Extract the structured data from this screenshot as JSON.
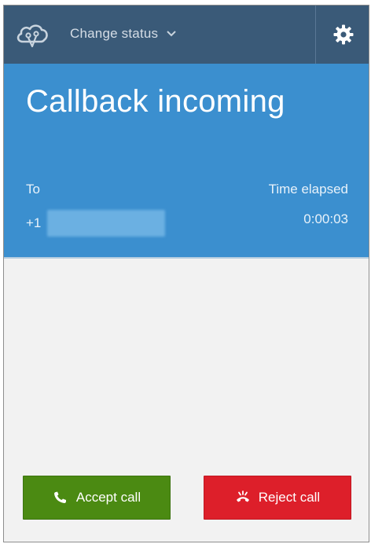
{
  "header": {
    "logo_icon": "cloud-agent-logo-icon",
    "status_label": "Change status",
    "status_chevron_icon": "chevron-down-icon",
    "settings_icon": "gear-icon"
  },
  "call": {
    "title": "Callback incoming",
    "to_label": "To",
    "to_number": "+1",
    "elapsed_label": "Time elapsed",
    "elapsed_value": "0:00:03"
  },
  "actions": {
    "accept_label": "Accept call",
    "accept_icon": "phone-icon",
    "accept_color": "#4b8a12",
    "reject_label": "Reject call",
    "reject_icon": "hang-up-icon",
    "reject_color": "#dd1f2a"
  },
  "colors": {
    "topbar": "#3a5a78",
    "call_panel": "#3b8fcf",
    "body": "#f2f2f2"
  }
}
